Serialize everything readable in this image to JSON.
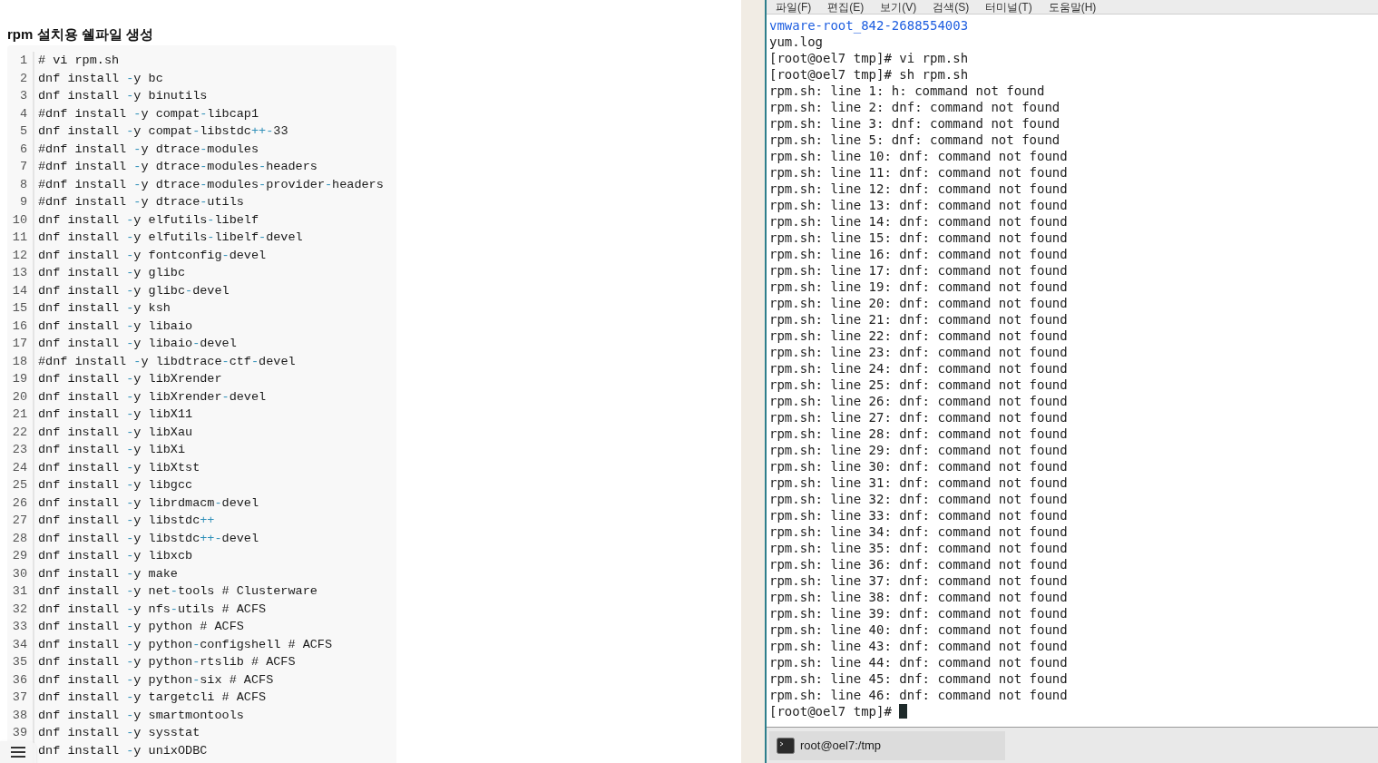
{
  "article": {
    "title": "rpm 설치용 쉘파일 생성",
    "code_lines": [
      {
        "num": "1",
        "text": "# vi rpm.sh"
      },
      {
        "num": "2",
        "text": "dnf install -y bc"
      },
      {
        "num": "3",
        "text": "dnf install -y binutils"
      },
      {
        "num": "4",
        "text": "#dnf install -y compat-libcap1"
      },
      {
        "num": "5",
        "text": "dnf install -y compat-libstdc++-33"
      },
      {
        "num": "6",
        "text": "#dnf install -y dtrace-modules"
      },
      {
        "num": "7",
        "text": "#dnf install -y dtrace-modules-headers"
      },
      {
        "num": "8",
        "text": "#dnf install -y dtrace-modules-provider-headers"
      },
      {
        "num": "9",
        "text": "#dnf install -y dtrace-utils"
      },
      {
        "num": "10",
        "text": "dnf install -y elfutils-libelf"
      },
      {
        "num": "11",
        "text": "dnf install -y elfutils-libelf-devel"
      },
      {
        "num": "12",
        "text": "dnf install -y fontconfig-devel"
      },
      {
        "num": "13",
        "text": "dnf install -y glibc"
      },
      {
        "num": "14",
        "text": "dnf install -y glibc-devel"
      },
      {
        "num": "15",
        "text": "dnf install -y ksh"
      },
      {
        "num": "16",
        "text": "dnf install -y libaio"
      },
      {
        "num": "17",
        "text": "dnf install -y libaio-devel"
      },
      {
        "num": "18",
        "text": "#dnf install -y libdtrace-ctf-devel"
      },
      {
        "num": "19",
        "text": "dnf install -y libXrender"
      },
      {
        "num": "20",
        "text": "dnf install -y libXrender-devel"
      },
      {
        "num": "21",
        "text": "dnf install -y libX11"
      },
      {
        "num": "22",
        "text": "dnf install -y libXau"
      },
      {
        "num": "23",
        "text": "dnf install -y libXi"
      },
      {
        "num": "24",
        "text": "dnf install -y libXtst"
      },
      {
        "num": "25",
        "text": "dnf install -y libgcc"
      },
      {
        "num": "26",
        "text": "dnf install -y librdmacm-devel"
      },
      {
        "num": "27",
        "text": "dnf install -y libstdc++"
      },
      {
        "num": "28",
        "text": "dnf install -y libstdc++-devel"
      },
      {
        "num": "29",
        "text": "dnf install -y libxcb"
      },
      {
        "num": "30",
        "text": "dnf install -y make"
      },
      {
        "num": "31",
        "text": "dnf install -y net-tools # Clusterware"
      },
      {
        "num": "32",
        "text": "dnf install -y nfs-utils # ACFS"
      },
      {
        "num": "33",
        "text": "dnf install -y python # ACFS"
      },
      {
        "num": "34",
        "text": "dnf install -y python-configshell # ACFS"
      },
      {
        "num": "35",
        "text": "dnf install -y python-rtslib # ACFS"
      },
      {
        "num": "36",
        "text": "dnf install -y python-six # ACFS"
      },
      {
        "num": "37",
        "text": "dnf install -y targetcli # ACFS"
      },
      {
        "num": "38",
        "text": "dnf install -y smartmontools"
      },
      {
        "num": "39",
        "text": "dnf install -y sysstat"
      },
      {
        "text": "dnf install -y unixODBC"
      }
    ]
  },
  "terminal": {
    "menu": [
      "파일(F)",
      "편집(E)",
      "보기(V)",
      "검색(S)",
      "터미널(T)",
      "도움말(H)"
    ],
    "lines": [
      {
        "kind": "dir",
        "text": "vmware-root_842-2688554003"
      },
      {
        "kind": "plain",
        "text": "yum.log"
      },
      {
        "kind": "plain",
        "text": "[root@oel7 tmp]# vi rpm.sh"
      },
      {
        "kind": "plain",
        "text": "[root@oel7 tmp]# sh rpm.sh"
      },
      {
        "kind": "plain",
        "text": "rpm.sh: line 1: h: command not found"
      },
      {
        "kind": "plain",
        "text": "rpm.sh: line 2: dnf: command not found"
      },
      {
        "kind": "plain",
        "text": "rpm.sh: line 3: dnf: command not found"
      },
      {
        "kind": "plain",
        "text": "rpm.sh: line 5: dnf: command not found"
      },
      {
        "kind": "plain",
        "text": "rpm.sh: line 10: dnf: command not found"
      },
      {
        "kind": "plain",
        "text": "rpm.sh: line 11: dnf: command not found"
      },
      {
        "kind": "plain",
        "text": "rpm.sh: line 12: dnf: command not found"
      },
      {
        "kind": "plain",
        "text": "rpm.sh: line 13: dnf: command not found"
      },
      {
        "kind": "plain",
        "text": "rpm.sh: line 14: dnf: command not found"
      },
      {
        "kind": "plain",
        "text": "rpm.sh: line 15: dnf: command not found"
      },
      {
        "kind": "plain",
        "text": "rpm.sh: line 16: dnf: command not found"
      },
      {
        "kind": "plain",
        "text": "rpm.sh: line 17: dnf: command not found"
      },
      {
        "kind": "plain",
        "text": "rpm.sh: line 19: dnf: command not found"
      },
      {
        "kind": "plain",
        "text": "rpm.sh: line 20: dnf: command not found"
      },
      {
        "kind": "plain",
        "text": "rpm.sh: line 21: dnf: command not found"
      },
      {
        "kind": "plain",
        "text": "rpm.sh: line 22: dnf: command not found"
      },
      {
        "kind": "plain",
        "text": "rpm.sh: line 23: dnf: command not found"
      },
      {
        "kind": "plain",
        "text": "rpm.sh: line 24: dnf: command not found"
      },
      {
        "kind": "plain",
        "text": "rpm.sh: line 25: dnf: command not found"
      },
      {
        "kind": "plain",
        "text": "rpm.sh: line 26: dnf: command not found"
      },
      {
        "kind": "plain",
        "text": "rpm.sh: line 27: dnf: command not found"
      },
      {
        "kind": "plain",
        "text": "rpm.sh: line 28: dnf: command not found"
      },
      {
        "kind": "plain",
        "text": "rpm.sh: line 29: dnf: command not found"
      },
      {
        "kind": "plain",
        "text": "rpm.sh: line 30: dnf: command not found"
      },
      {
        "kind": "plain",
        "text": "rpm.sh: line 31: dnf: command not found"
      },
      {
        "kind": "plain",
        "text": "rpm.sh: line 32: dnf: command not found"
      },
      {
        "kind": "plain",
        "text": "rpm.sh: line 33: dnf: command not found"
      },
      {
        "kind": "plain",
        "text": "rpm.sh: line 34: dnf: command not found"
      },
      {
        "kind": "plain",
        "text": "rpm.sh: line 35: dnf: command not found"
      },
      {
        "kind": "plain",
        "text": "rpm.sh: line 36: dnf: command not found"
      },
      {
        "kind": "plain",
        "text": "rpm.sh: line 37: dnf: command not found"
      },
      {
        "kind": "plain",
        "text": "rpm.sh: line 38: dnf: command not found"
      },
      {
        "kind": "plain",
        "text": "rpm.sh: line 39: dnf: command not found"
      },
      {
        "kind": "plain",
        "text": "rpm.sh: line 40: dnf: command not found"
      },
      {
        "kind": "plain",
        "text": "rpm.sh: line 43: dnf: command not found"
      },
      {
        "kind": "plain",
        "text": "rpm.sh: line 44: dnf: command not found"
      },
      {
        "kind": "plain",
        "text": "rpm.sh: line 45: dnf: command not found"
      },
      {
        "kind": "plain",
        "text": "rpm.sh: line 46: dnf: command not found"
      },
      {
        "kind": "prompt",
        "text": "[root@oel7 tmp]#"
      }
    ],
    "taskbar": {
      "label": "root@oel7:/tmp"
    }
  }
}
